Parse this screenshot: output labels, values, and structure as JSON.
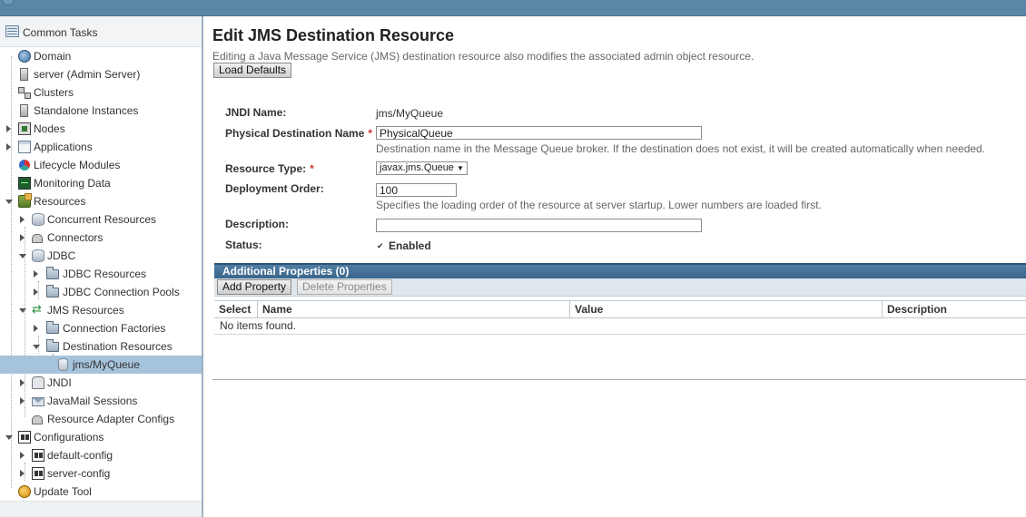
{
  "sidebar": {
    "common_tasks": "Common Tasks",
    "items": [
      {
        "label": "Domain",
        "icon": "globe-icon"
      },
      {
        "label": "server (Admin Server)",
        "icon": "server-icon"
      },
      {
        "label": "Clusters",
        "icon": "cluster-icon"
      },
      {
        "label": "Standalone Instances",
        "icon": "server-icon"
      },
      {
        "label": "Nodes",
        "icon": "nodes-icon"
      },
      {
        "label": "Applications",
        "icon": "applications-icon"
      },
      {
        "label": "Lifecycle Modules",
        "icon": "lifecycle-icon"
      },
      {
        "label": "Monitoring Data",
        "icon": "monitor-icon"
      },
      {
        "label": "Resources",
        "icon": "resources-icon"
      },
      {
        "label": "Concurrent Resources",
        "icon": "database-icon"
      },
      {
        "label": "Connectors",
        "icon": "connector-icon"
      },
      {
        "label": "JDBC",
        "icon": "database-icon"
      },
      {
        "label": "JDBC Resources",
        "icon": "folder-icon"
      },
      {
        "label": "JDBC Connection Pools",
        "icon": "folder-icon"
      },
      {
        "label": "JMS Resources",
        "icon": "jms-icon"
      },
      {
        "label": "Connection Factories",
        "icon": "folder-icon"
      },
      {
        "label": "Destination Resources",
        "icon": "folder-icon"
      },
      {
        "label": "jms/MyQueue",
        "icon": "queue-icon"
      },
      {
        "label": "JNDI",
        "icon": "jndi-icon"
      },
      {
        "label": "JavaMail Sessions",
        "icon": "mail-icon"
      },
      {
        "label": "Resource Adapter Configs",
        "icon": "connector-icon"
      },
      {
        "label": "Configurations",
        "icon": "config-icon"
      },
      {
        "label": "default-config",
        "icon": "config-icon"
      },
      {
        "label": "server-config",
        "icon": "config-icon"
      },
      {
        "label": "Update Tool",
        "icon": "update-icon"
      }
    ]
  },
  "main": {
    "title": "Edit JMS Destination Resource",
    "description": "Editing a Java Message Service (JMS) destination resource also modifies the associated admin object resource.",
    "load_defaults": "Load Defaults",
    "form": {
      "jndi_name_label": "JNDI Name:",
      "jndi_name_value": "jms/MyQueue",
      "phys_dest_label": "Physical Destination Name",
      "phys_dest_value": "PhysicalQueue",
      "phys_dest_help": "Destination name in the Message Queue broker. If the destination does not exist, it will be created automatically when needed.",
      "resource_type_label": "Resource Type:",
      "resource_type_value": "javax.jms.Queue",
      "deploy_order_label": "Deployment Order:",
      "deploy_order_value": "100",
      "deploy_order_help": "Specifies the loading order of the resource at server startup. Lower numbers are loaded first.",
      "description_label": "Description:",
      "description_value": "",
      "status_label": "Status:",
      "status_enabled": "Enabled",
      "required_mark": "*"
    },
    "properties": {
      "title": "Additional Properties (0)",
      "add_button": "Add Property",
      "delete_button": "Delete Properties",
      "columns": [
        "Select",
        "Name",
        "Value",
        "Description"
      ],
      "empty": "No items found."
    }
  },
  "colors": {
    "header_bar": "#5b86a6",
    "selected_row": "#a6c3dc",
    "table_title": "#3b668b",
    "required": "#cc3333"
  }
}
